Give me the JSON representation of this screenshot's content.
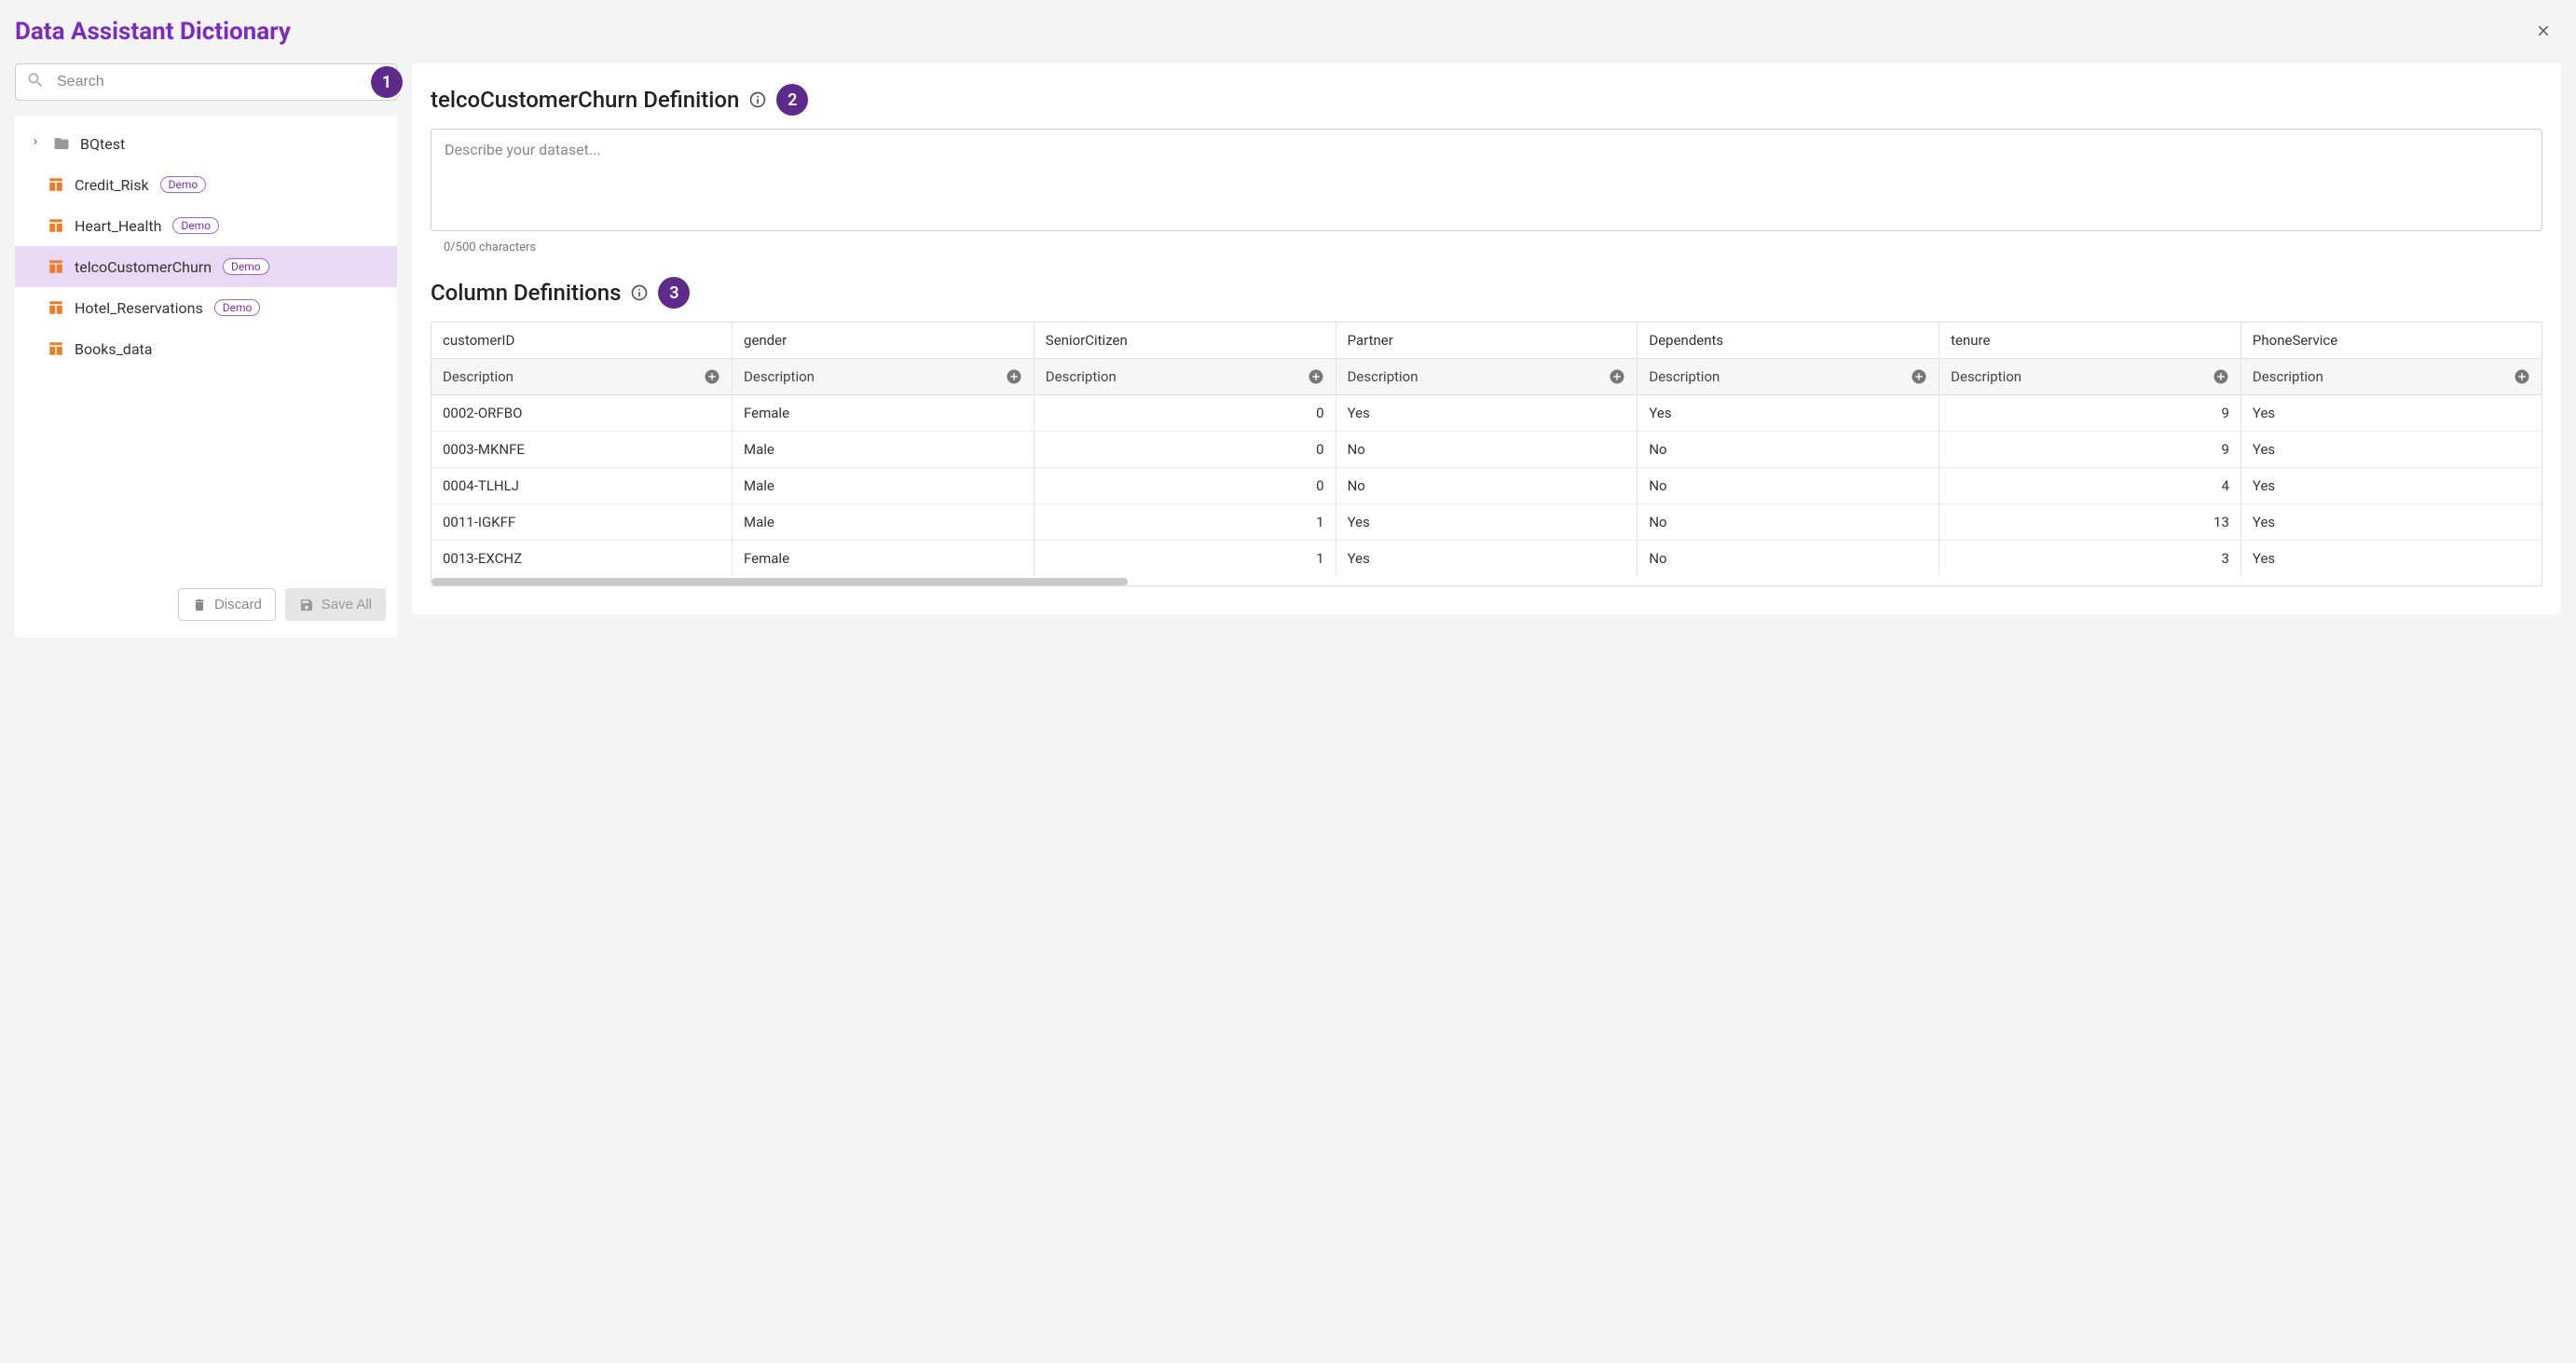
{
  "header": {
    "title": "Data Assistant Dictionary"
  },
  "search": {
    "placeholder": "Search",
    "value": ""
  },
  "annotations": [
    "1",
    "2",
    "3"
  ],
  "sidebar": {
    "folder": {
      "label": "BQtest"
    },
    "items": [
      {
        "label": "Credit_Risk",
        "demo": true
      },
      {
        "label": "Heart_Health",
        "demo": true
      },
      {
        "label": "telcoCustomerChurn",
        "demo": true,
        "selected": true
      },
      {
        "label": "Hotel_Reservations",
        "demo": true
      },
      {
        "label": "Books_data",
        "demo": false
      }
    ],
    "demo_badge": "Demo",
    "buttons": {
      "discard": "Discard",
      "save": "Save All"
    }
  },
  "definition": {
    "title": "telcoCustomerChurn Definition",
    "placeholder": "Describe your dataset...",
    "char_count": "0/500 characters"
  },
  "columns_section": {
    "title": "Column Definitions",
    "desc_label": "Description",
    "headers": [
      "customerID",
      "gender",
      "SeniorCitizen",
      "Partner",
      "Dependents",
      "tenure",
      "PhoneService"
    ],
    "numeric_cols": [
      2,
      5
    ],
    "rows": [
      [
        "0002-ORFBO",
        "Female",
        "0",
        "Yes",
        "Yes",
        "9",
        "Yes"
      ],
      [
        "0003-MKNFE",
        "Male",
        "0",
        "No",
        "No",
        "9",
        "Yes"
      ],
      [
        "0004-TLHLJ",
        "Male",
        "0",
        "No",
        "No",
        "4",
        "Yes"
      ],
      [
        "0011-IGKFF",
        "Male",
        "1",
        "Yes",
        "No",
        "13",
        "Yes"
      ],
      [
        "0013-EXCHZ",
        "Female",
        "1",
        "Yes",
        "No",
        "3",
        "Yes"
      ]
    ]
  }
}
